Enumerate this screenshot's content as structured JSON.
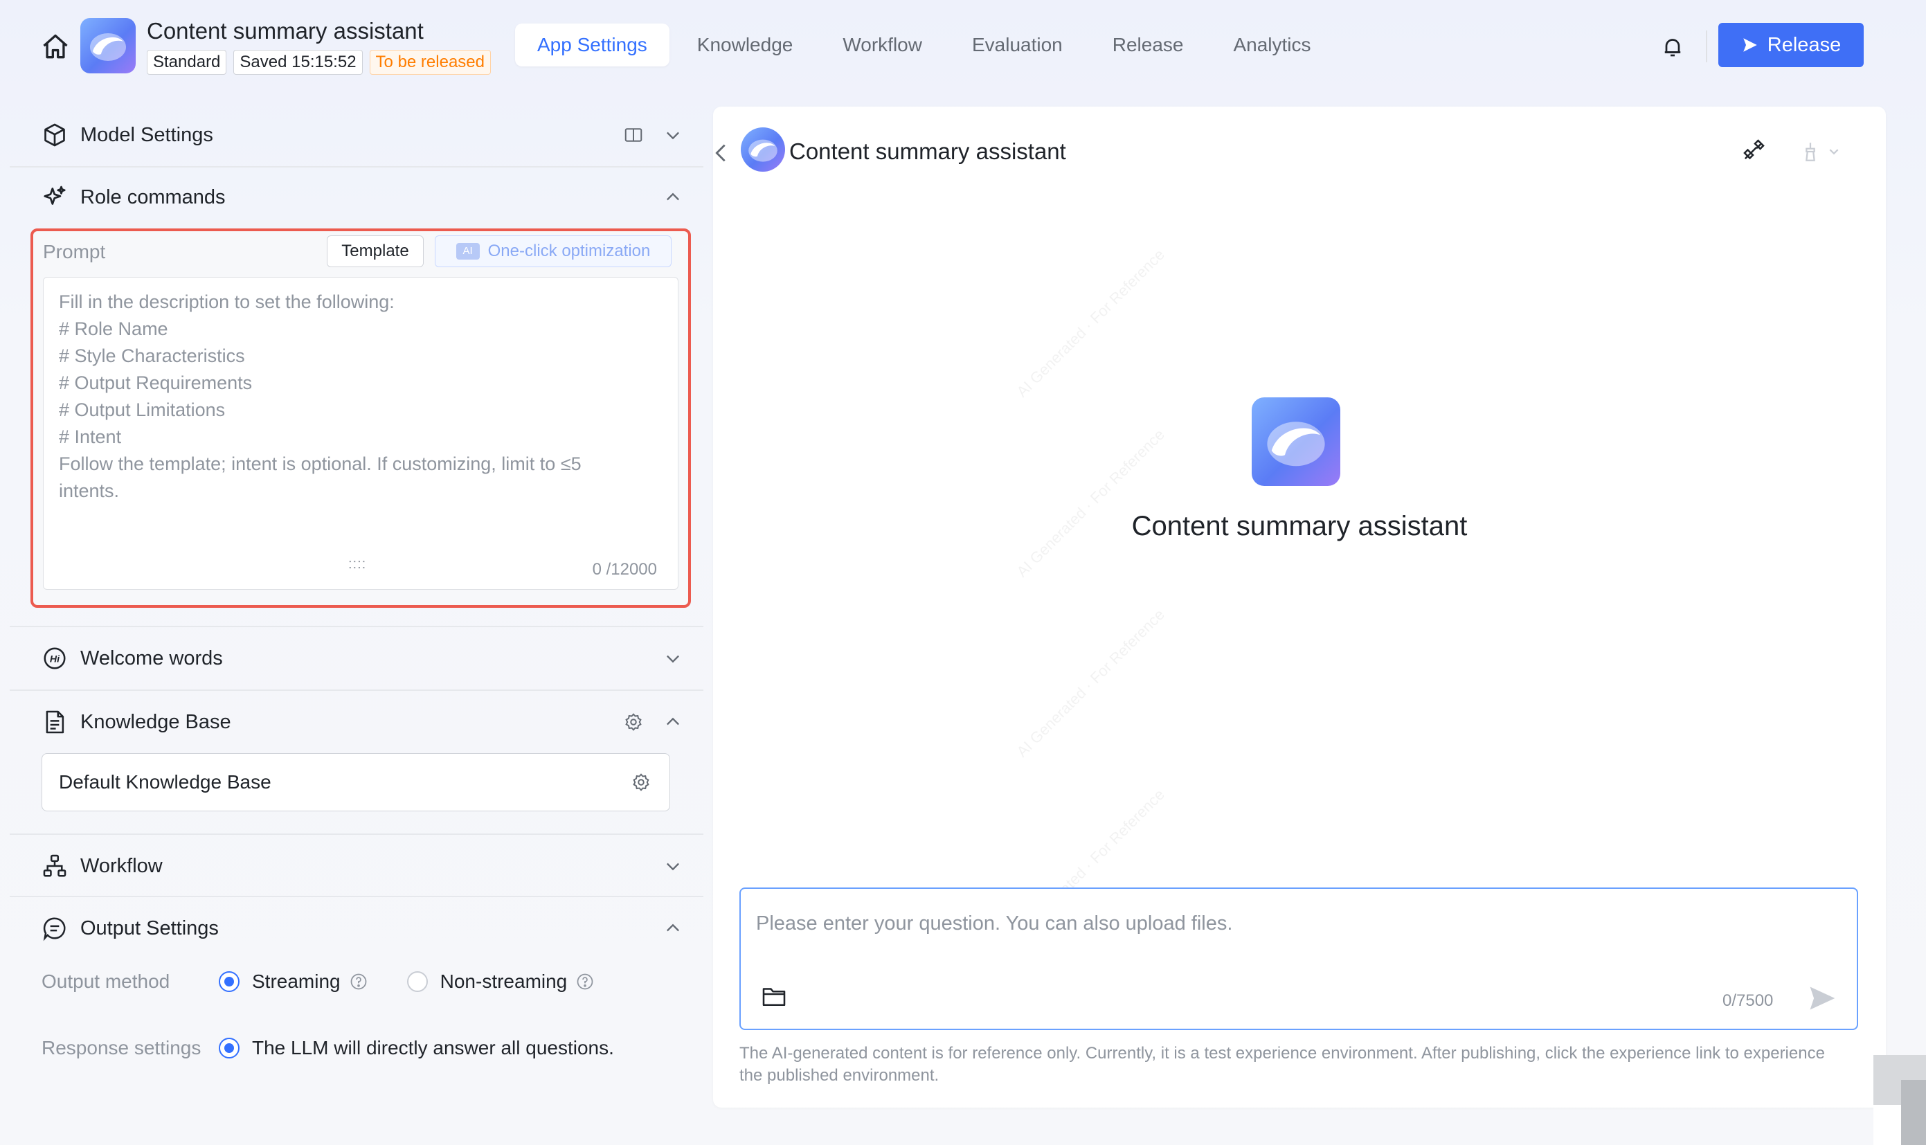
{
  "header": {
    "app_title": "Content summary assistant",
    "badges": [
      "Standard",
      "Saved 15:15:52",
      "To be released"
    ],
    "tabs": [
      "App Settings",
      "Knowledge",
      "Workflow",
      "Evaluation",
      "Release",
      "Analytics"
    ],
    "active_tab": "App Settings",
    "release_label": "Release"
  },
  "left": {
    "model_settings": "Model Settings",
    "role_commands": "Role commands",
    "prompt": {
      "label": "Prompt",
      "template_label": "Template",
      "ai_badge": "AI",
      "optimize_label": "One-click optimization",
      "placeholder_lines": [
        "Fill in the description to set the following:",
        "# Role Name",
        "# Style Characteristics",
        "# Output Requirements",
        "# Output Limitations",
        "# Intent",
        "Follow the template; intent is optional. If customizing, limit to ≤5",
        "intents."
      ],
      "resize_handle": "::::",
      "char_count": "0 /12000"
    },
    "welcome_words": "Welcome words",
    "knowledge_base": "Knowledge Base",
    "default_kb": "Default Knowledge Base",
    "workflow": "Workflow",
    "output_settings": "Output Settings",
    "output_method_label": "Output method",
    "streaming_label": "Streaming",
    "non_streaming_label": "Non-streaming",
    "response_settings_label": "Response settings",
    "response_option": "The LLM will directly answer all questions."
  },
  "right": {
    "chat_title": "Content summary assistant",
    "center_title": "Content summary assistant",
    "watermark": "AI Generated · For Reference",
    "input_placeholder": "Please enter your question. You can also upload files.",
    "char_count": "0/7500",
    "disclaimer": "The AI-generated content is for reference only. Currently, it is a test experience environment. After publishing, click the experience link to experience the published environment."
  },
  "colors": {
    "accent": "#3370ff",
    "release_button": "#3f6ff6",
    "highlight_border": "#ec5b4f",
    "warning": "#ff7d00"
  },
  "icons": [
    "home-icon",
    "bell-icon",
    "send-icon",
    "cube-icon",
    "sparkle-icon",
    "hi-icon",
    "document-icon",
    "gear-icon",
    "workflow-icon",
    "chat-bubble-icon",
    "chevron-down-icon",
    "chevron-up-icon",
    "layout-icon",
    "help-icon",
    "link-icon",
    "clean-icon",
    "folder-icon"
  ]
}
